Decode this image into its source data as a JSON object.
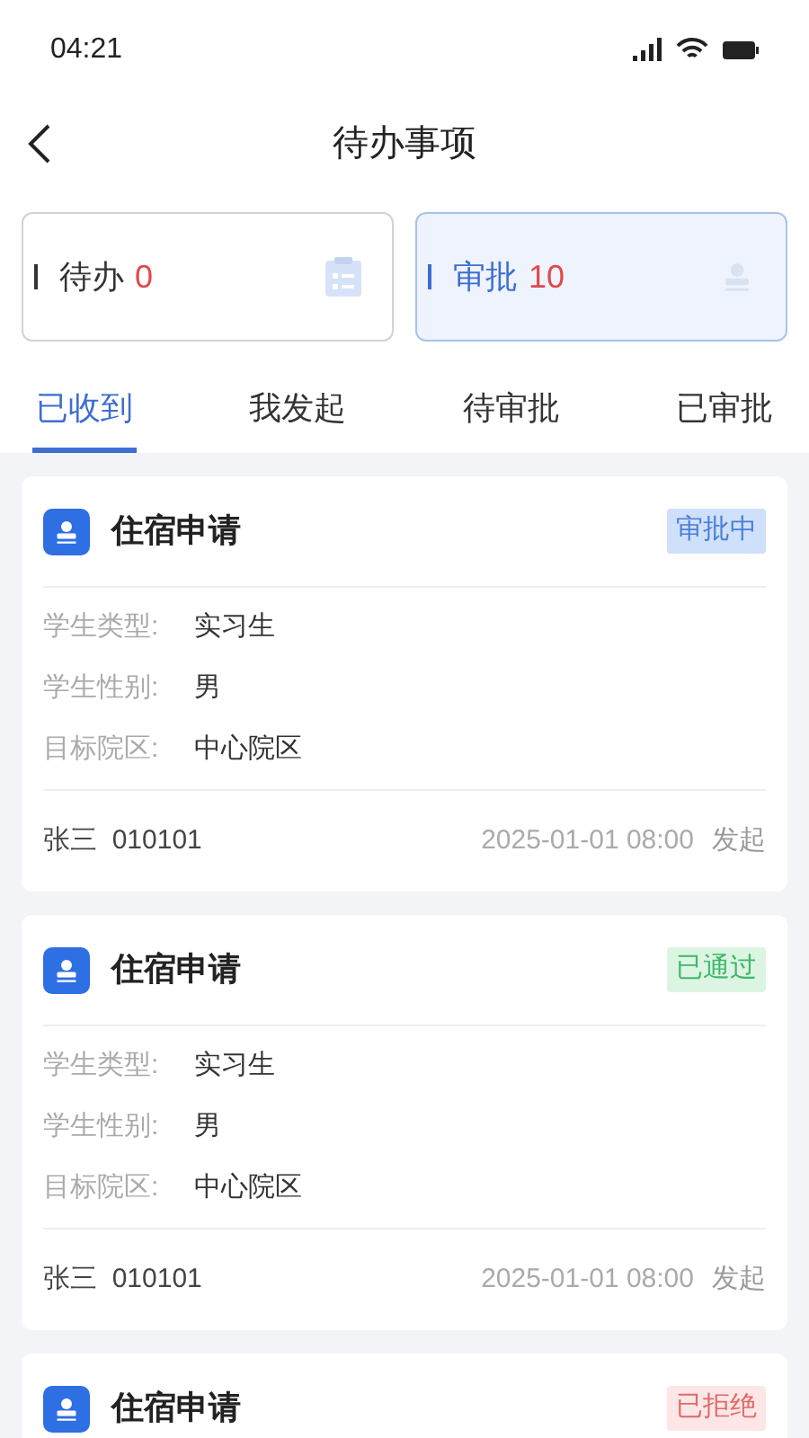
{
  "status_bar": {
    "time": "04:21"
  },
  "header": {
    "title": "待办事项"
  },
  "summary": [
    {
      "label": "待办",
      "count": "0",
      "selected": false,
      "kind": "todo"
    },
    {
      "label": "审批",
      "count": "10",
      "selected": true,
      "kind": "approval"
    }
  ],
  "tabs": [
    {
      "label": "已收到",
      "selected": true
    },
    {
      "label": "我发起",
      "selected": false
    },
    {
      "label": "待审批",
      "selected": false
    },
    {
      "label": "已审批",
      "selected": false
    }
  ],
  "cards": [
    {
      "title": "住宿申请",
      "status": "审批中",
      "kind": "pending",
      "fields": [
        {
          "label": "学生类型:",
          "value": "实习生"
        },
        {
          "label": "学生性别:",
          "value": "男"
        },
        {
          "label": "目标院区:",
          "value": "中心院区"
        }
      ],
      "applicant": "张三  010101",
      "time": "2025-01-01 08:00",
      "action": "发起"
    },
    {
      "title": "住宿申请",
      "status": "已通过",
      "kind": "approved",
      "fields": [
        {
          "label": "学生类型:",
          "value": "实习生"
        },
        {
          "label": "学生性别:",
          "value": "男"
        },
        {
          "label": "目标院区:",
          "value": "中心院区"
        }
      ],
      "applicant": "张三  010101",
      "time": "2025-01-01 08:00",
      "action": "发起"
    },
    {
      "title": "住宿申请",
      "status": "已拒绝",
      "kind": "rejected"
    }
  ]
}
